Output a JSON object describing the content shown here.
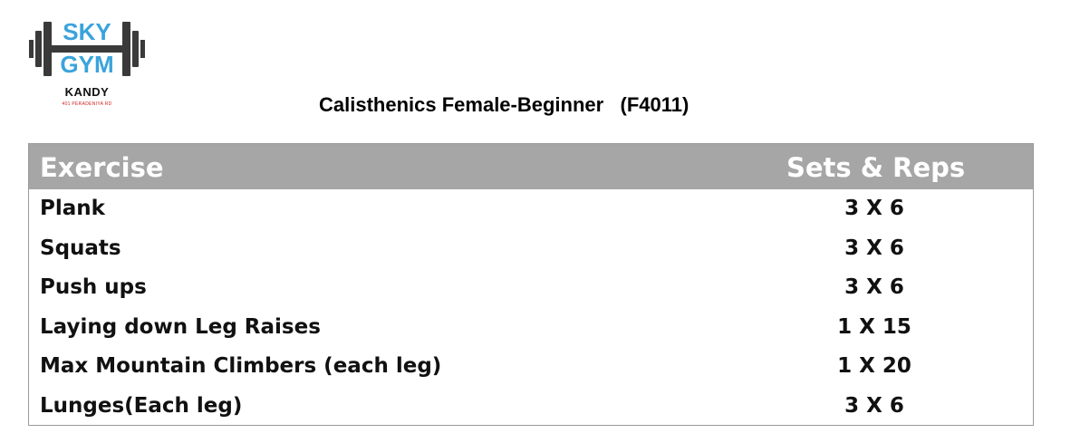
{
  "logo": {
    "line1": "SKY",
    "line2": "GYM",
    "city": "KANDY",
    "address": "401 PERADENIYA RD",
    "colors": {
      "text": "#3aa3dc",
      "dumbbell": "#3a3a3a"
    }
  },
  "title": "Calisthenics Female-Beginner   (F4011)",
  "table": {
    "header_color": "#a6a6a6",
    "headers": {
      "exercise": "Exercise",
      "sets_reps": "Sets & Reps"
    },
    "rows": [
      {
        "exercise": "Plank",
        "sets_reps": "3 X 6"
      },
      {
        "exercise": "Squats",
        "sets_reps": "3 X 6"
      },
      {
        "exercise": "Push ups",
        "sets_reps": "3 X 6"
      },
      {
        "exercise": "Laying down Leg Raises",
        "sets_reps": "1 X 15"
      },
      {
        "exercise": "Max Mountain Climbers (each leg)",
        "sets_reps": "1 X 20"
      },
      {
        "exercise": "Lunges(Each leg)",
        "sets_reps": "3 X 6"
      }
    ]
  }
}
